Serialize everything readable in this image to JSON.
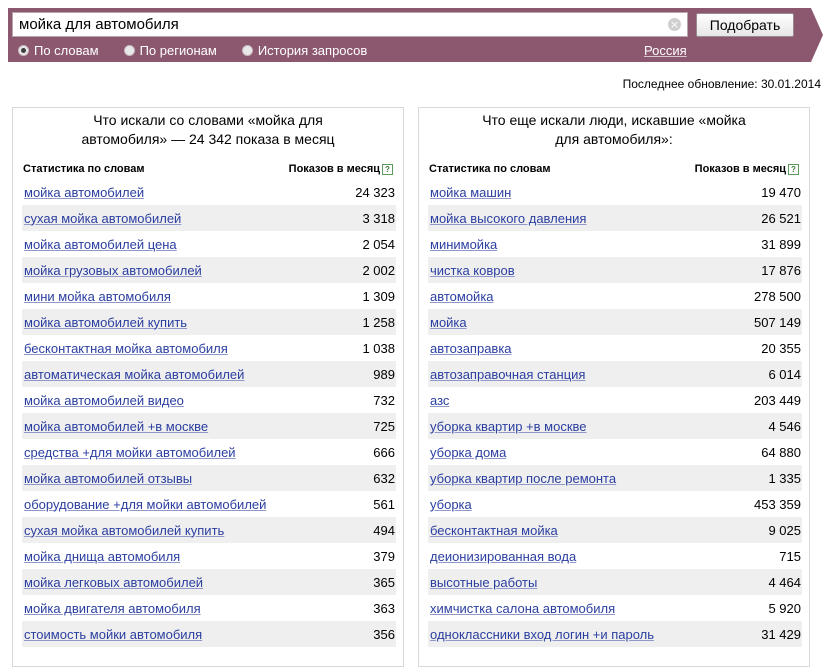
{
  "search": {
    "query": "мойка для автомобиля",
    "submit_label": "Подобрать",
    "modes": [
      {
        "label": "По словам",
        "checked": true
      },
      {
        "label": "По регионам",
        "checked": false
      },
      {
        "label": "История запросов",
        "checked": false
      }
    ],
    "region": "Россия"
  },
  "updated": "Последнее обновление: 30.01.2014",
  "left_panel": {
    "title": "Что искали со словами «мойка для автомобиля» — 24 342 показа в месяц",
    "col_phrase": "Статистика по словам",
    "col_count": "Показов в месяц",
    "rows": [
      {
        "phrase": "мойка автомобилей",
        "count": "24 323"
      },
      {
        "phrase": "сухая мойка автомобилей",
        "count": "3 318"
      },
      {
        "phrase": "мойка автомобилей цена",
        "count": "2 054"
      },
      {
        "phrase": "мойка грузовых автомобилей",
        "count": "2 002"
      },
      {
        "phrase": "мини мойка автомобиля",
        "count": "1 309"
      },
      {
        "phrase": "мойка автомобилей купить",
        "count": "1 258"
      },
      {
        "phrase": "бесконтактная мойка автомобиля",
        "count": "1 038"
      },
      {
        "phrase": "автоматическая мойка автомобилей",
        "count": "989"
      },
      {
        "phrase": "мойка автомобилей видео",
        "count": "732"
      },
      {
        "phrase": "мойка автомобилей +в москве",
        "count": "725"
      },
      {
        "phrase": "средства +для мойки автомобилей",
        "count": "666"
      },
      {
        "phrase": "мойка автомобилей отзывы",
        "count": "632"
      },
      {
        "phrase": "оборудование +для мойки автомобилей",
        "count": "561"
      },
      {
        "phrase": "сухая мойка автомобилей купить",
        "count": "494"
      },
      {
        "phrase": "мойка днища автомобиля",
        "count": "379"
      },
      {
        "phrase": "мойка легковых автомобилей",
        "count": "365"
      },
      {
        "phrase": "мойка двигателя автомобиля",
        "count": "363"
      },
      {
        "phrase": "стоимость мойки автомобиля",
        "count": "356"
      }
    ]
  },
  "right_panel": {
    "title": "Что еще искали люди, искавшие «мойка для автомобиля»:",
    "col_phrase": "Статистика по словам",
    "col_count": "Показов в месяц",
    "rows": [
      {
        "phrase": "мойка машин",
        "count": "19 470"
      },
      {
        "phrase": "мойка высокого давления",
        "count": "26 521"
      },
      {
        "phrase": "минимойка",
        "count": "31 899"
      },
      {
        "phrase": "чистка ковров",
        "count": "17 876"
      },
      {
        "phrase": "автомойка",
        "count": "278 500"
      },
      {
        "phrase": "мойка",
        "count": "507 149"
      },
      {
        "phrase": "автозаправка",
        "count": "20 355"
      },
      {
        "phrase": "автозаправочная станция",
        "count": "6 014"
      },
      {
        "phrase": "азс",
        "count": "203 449"
      },
      {
        "phrase": "уборка квартир +в москве",
        "count": "4 546"
      },
      {
        "phrase": "уборка дома",
        "count": "64 880"
      },
      {
        "phrase": "уборка квартир после ремонта",
        "count": "1 335"
      },
      {
        "phrase": "уборка",
        "count": "453 359"
      },
      {
        "phrase": "бесконтактная мойка",
        "count": "9 025"
      },
      {
        "phrase": "деионизированная вода",
        "count": "715"
      },
      {
        "phrase": "высотные работы",
        "count": "4 464"
      },
      {
        "phrase": "химчистка салона автомобиля",
        "count": "5 920"
      },
      {
        "phrase": "одноклассники вход логин +и пароль",
        "count": "31 429"
      }
    ]
  }
}
